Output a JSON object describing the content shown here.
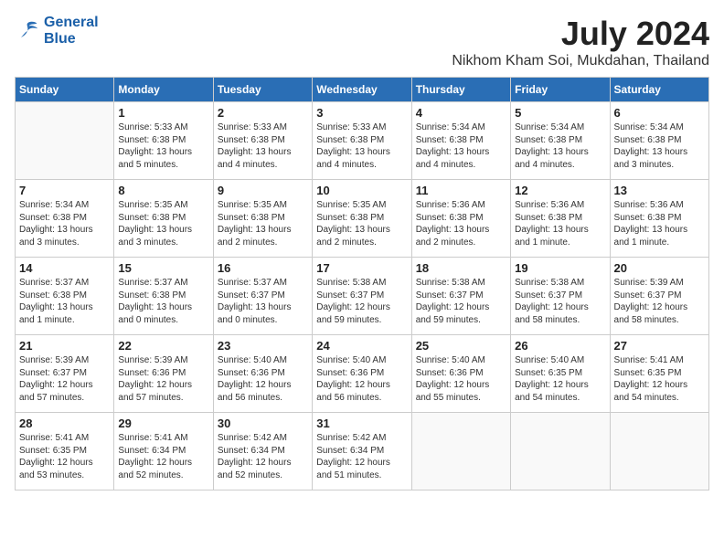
{
  "header": {
    "logo_line1": "General",
    "logo_line2": "Blue",
    "main_title": "July 2024",
    "subtitle": "Nikhom Kham Soi, Mukdahan, Thailand"
  },
  "calendar": {
    "days_of_week": [
      "Sunday",
      "Monday",
      "Tuesday",
      "Wednesday",
      "Thursday",
      "Friday",
      "Saturday"
    ],
    "weeks": [
      [
        {
          "day": null
        },
        {
          "day": "1",
          "sunrise": "5:33 AM",
          "sunset": "6:38 PM",
          "daylight": "13 hours and 5 minutes."
        },
        {
          "day": "2",
          "sunrise": "5:33 AM",
          "sunset": "6:38 PM",
          "daylight": "13 hours and 4 minutes."
        },
        {
          "day": "3",
          "sunrise": "5:33 AM",
          "sunset": "6:38 PM",
          "daylight": "13 hours and 4 minutes."
        },
        {
          "day": "4",
          "sunrise": "5:34 AM",
          "sunset": "6:38 PM",
          "daylight": "13 hours and 4 minutes."
        },
        {
          "day": "5",
          "sunrise": "5:34 AM",
          "sunset": "6:38 PM",
          "daylight": "13 hours and 4 minutes."
        },
        {
          "day": "6",
          "sunrise": "5:34 AM",
          "sunset": "6:38 PM",
          "daylight": "13 hours and 3 minutes."
        }
      ],
      [
        {
          "day": "7",
          "sunrise": "5:34 AM",
          "sunset": "6:38 PM",
          "daylight": "13 hours and 3 minutes."
        },
        {
          "day": "8",
          "sunrise": "5:35 AM",
          "sunset": "6:38 PM",
          "daylight": "13 hours and 3 minutes."
        },
        {
          "day": "9",
          "sunrise": "5:35 AM",
          "sunset": "6:38 PM",
          "daylight": "13 hours and 2 minutes."
        },
        {
          "day": "10",
          "sunrise": "5:35 AM",
          "sunset": "6:38 PM",
          "daylight": "13 hours and 2 minutes."
        },
        {
          "day": "11",
          "sunrise": "5:36 AM",
          "sunset": "6:38 PM",
          "daylight": "13 hours and 2 minutes."
        },
        {
          "day": "12",
          "sunrise": "5:36 AM",
          "sunset": "6:38 PM",
          "daylight": "13 hours and 1 minute."
        },
        {
          "day": "13",
          "sunrise": "5:36 AM",
          "sunset": "6:38 PM",
          "daylight": "13 hours and 1 minute."
        }
      ],
      [
        {
          "day": "14",
          "sunrise": "5:37 AM",
          "sunset": "6:38 PM",
          "daylight": "13 hours and 1 minute."
        },
        {
          "day": "15",
          "sunrise": "5:37 AM",
          "sunset": "6:38 PM",
          "daylight": "13 hours and 0 minutes."
        },
        {
          "day": "16",
          "sunrise": "5:37 AM",
          "sunset": "6:37 PM",
          "daylight": "13 hours and 0 minutes."
        },
        {
          "day": "17",
          "sunrise": "5:38 AM",
          "sunset": "6:37 PM",
          "daylight": "12 hours and 59 minutes."
        },
        {
          "day": "18",
          "sunrise": "5:38 AM",
          "sunset": "6:37 PM",
          "daylight": "12 hours and 59 minutes."
        },
        {
          "day": "19",
          "sunrise": "5:38 AM",
          "sunset": "6:37 PM",
          "daylight": "12 hours and 58 minutes."
        },
        {
          "day": "20",
          "sunrise": "5:39 AM",
          "sunset": "6:37 PM",
          "daylight": "12 hours and 58 minutes."
        }
      ],
      [
        {
          "day": "21",
          "sunrise": "5:39 AM",
          "sunset": "6:37 PM",
          "daylight": "12 hours and 57 minutes."
        },
        {
          "day": "22",
          "sunrise": "5:39 AM",
          "sunset": "6:36 PM",
          "daylight": "12 hours and 57 minutes."
        },
        {
          "day": "23",
          "sunrise": "5:40 AM",
          "sunset": "6:36 PM",
          "daylight": "12 hours and 56 minutes."
        },
        {
          "day": "24",
          "sunrise": "5:40 AM",
          "sunset": "6:36 PM",
          "daylight": "12 hours and 56 minutes."
        },
        {
          "day": "25",
          "sunrise": "5:40 AM",
          "sunset": "6:36 PM",
          "daylight": "12 hours and 55 minutes."
        },
        {
          "day": "26",
          "sunrise": "5:40 AM",
          "sunset": "6:35 PM",
          "daylight": "12 hours and 54 minutes."
        },
        {
          "day": "27",
          "sunrise": "5:41 AM",
          "sunset": "6:35 PM",
          "daylight": "12 hours and 54 minutes."
        }
      ],
      [
        {
          "day": "28",
          "sunrise": "5:41 AM",
          "sunset": "6:35 PM",
          "daylight": "12 hours and 53 minutes."
        },
        {
          "day": "29",
          "sunrise": "5:41 AM",
          "sunset": "6:34 PM",
          "daylight": "12 hours and 52 minutes."
        },
        {
          "day": "30",
          "sunrise": "5:42 AM",
          "sunset": "6:34 PM",
          "daylight": "12 hours and 52 minutes."
        },
        {
          "day": "31",
          "sunrise": "5:42 AM",
          "sunset": "6:34 PM",
          "daylight": "12 hours and 51 minutes."
        },
        {
          "day": null
        },
        {
          "day": null
        },
        {
          "day": null
        }
      ]
    ]
  }
}
